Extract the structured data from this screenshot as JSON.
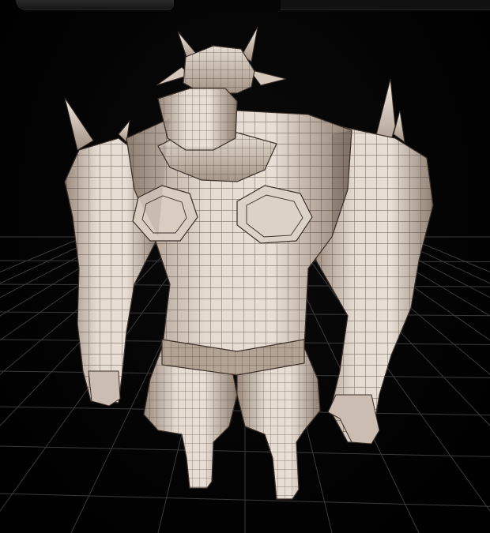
{
  "viewport": {
    "background": "#000000",
    "grid_color": "#3a3a3a",
    "model_fill_light": "#e6dcd2",
    "model_fill_mid": "#bfb0a3",
    "model_fill_dark": "#7d6f64",
    "wire_color": "#3b302a"
  },
  "model": {
    "name_icon": "minotaur-mesh-icon"
  }
}
